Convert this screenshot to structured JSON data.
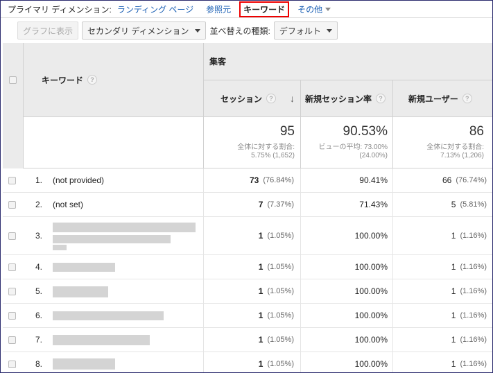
{
  "primary_dimension": {
    "label": "プライマリ ディメンション:",
    "options": [
      {
        "label": "ランディング ページ"
      },
      {
        "label": "参照元"
      }
    ],
    "active": "キーワード",
    "more": "その他"
  },
  "toolbar": {
    "graph_button": "グラフに表示",
    "secondary_dimension": "セカンダリ ディメンション",
    "sort_label": "並べ替えの種類:",
    "sort_value": "デフォルト"
  },
  "table": {
    "keyword_header": "キーワード",
    "group_header": "集客",
    "columns": [
      "セッション",
      "新規セッション率",
      "新規ユーザー"
    ],
    "help_glyph": "?",
    "sort_arrow": "↓",
    "totals": {
      "sessions": {
        "value": "95",
        "line1": "全体に対する割合:",
        "line2": "5.75% (1,652)"
      },
      "new_rate": {
        "value": "90.53%",
        "line1": "ビューの平均: 73.00%",
        "line2": "(24.00%)"
      },
      "new_users": {
        "value": "86",
        "line1": "全体に対する割合:",
        "line2": "7.13% (1,206)"
      }
    },
    "rows": [
      {
        "idx": "1.",
        "keyword": "(not provided)",
        "sessions": "73",
        "sessions_pct": "(76.84%)",
        "new_rate": "90.41%",
        "new_users": "66",
        "new_users_pct": "(76.74%)"
      },
      {
        "idx": "2.",
        "keyword": "(not set)",
        "sessions": "7",
        "sessions_pct": "(7.37%)",
        "new_rate": "71.43%",
        "new_users": "5",
        "new_users_pct": "(5.81%)"
      },
      {
        "idx": "3.",
        "keyword": "",
        "sessions": "1",
        "sessions_pct": "(1.05%)",
        "new_rate": "100.00%",
        "new_users": "1",
        "new_users_pct": "(1.16%)"
      },
      {
        "idx": "4.",
        "keyword": "",
        "sessions": "1",
        "sessions_pct": "(1.05%)",
        "new_rate": "100.00%",
        "new_users": "1",
        "new_users_pct": "(1.16%)"
      },
      {
        "idx": "5.",
        "keyword": "",
        "sessions": "1",
        "sessions_pct": "(1.05%)",
        "new_rate": "100.00%",
        "new_users": "1",
        "new_users_pct": "(1.16%)"
      },
      {
        "idx": "6.",
        "keyword": "",
        "sessions": "1",
        "sessions_pct": "(1.05%)",
        "new_rate": "100.00%",
        "new_users": "1",
        "new_users_pct": "(1.16%)"
      },
      {
        "idx": "7.",
        "keyword": "",
        "sessions": "1",
        "sessions_pct": "(1.05%)",
        "new_rate": "100.00%",
        "new_users": "1",
        "new_users_pct": "(1.16%)"
      },
      {
        "idx": "8.",
        "keyword": "",
        "sessions": "1",
        "sessions_pct": "(1.05%)",
        "new_rate": "100.00%",
        "new_users": "1",
        "new_users_pct": "(1.16%)"
      }
    ]
  }
}
